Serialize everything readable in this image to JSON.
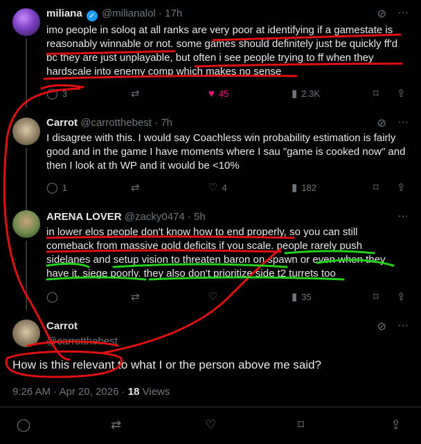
{
  "tweets": [
    {
      "name": "miliana",
      "handle": "@milianalol",
      "time": "17h",
      "verified": true,
      "text": "imo people in soloq at all ranks are very poor at identifying if a gamestate is reasonably winnable or not. some games should definitely just be quickly ff'd bc they are just unplayable, but often i see people trying to ff when they hardscale into enemy comp which makes no sense",
      "replies": "3",
      "likes": "45",
      "views": "2.3K"
    },
    {
      "name": "Carrot",
      "handle": "@carrotthebest",
      "time": "7h",
      "text": "I disagree with this. I would say Coachless win probability estimation is fairly good and in the game I have moments where I sau \"game is cooked now\" and then I look at th WP and it would be <10%",
      "replies": "1",
      "likes": "4",
      "views": "182"
    },
    {
      "name": "ARENA LOVER",
      "handle": "@zacky0474",
      "time": "5h",
      "text": "in lower elos people don't know how to end properly, so you can still comeback from massive gold deficits if you scale. people rarely push sidelanes and setup vision to threaten baron on spawn or even when they have it, siege poorly. they also don't prioritize side t2 turrets too",
      "views": "35"
    }
  ],
  "main": {
    "name": "Carrot",
    "handle": "@carrotthebest",
    "text": "How is this relevant to what I or the person above me said?",
    "timestamp": "9:26 AM · Apr 20, 2026 ·",
    "views_count": "18",
    "views_label": "Views"
  },
  "separator": "·",
  "icons": {
    "reply": "reply-icon",
    "repost": "repost-icon",
    "like": "heart-icon",
    "views": "views-icon",
    "bookmark": "bookmark-icon",
    "share": "share-icon",
    "grok": "grok-icon",
    "more": "more-icon"
  },
  "colors": {
    "background": "#000000",
    "text": "#e7e9ea",
    "muted": "#71767b",
    "verified": "#1d9bf0",
    "like": "#f91880",
    "annotation_red": "#e01010",
    "annotation_green": "#22d11a"
  }
}
